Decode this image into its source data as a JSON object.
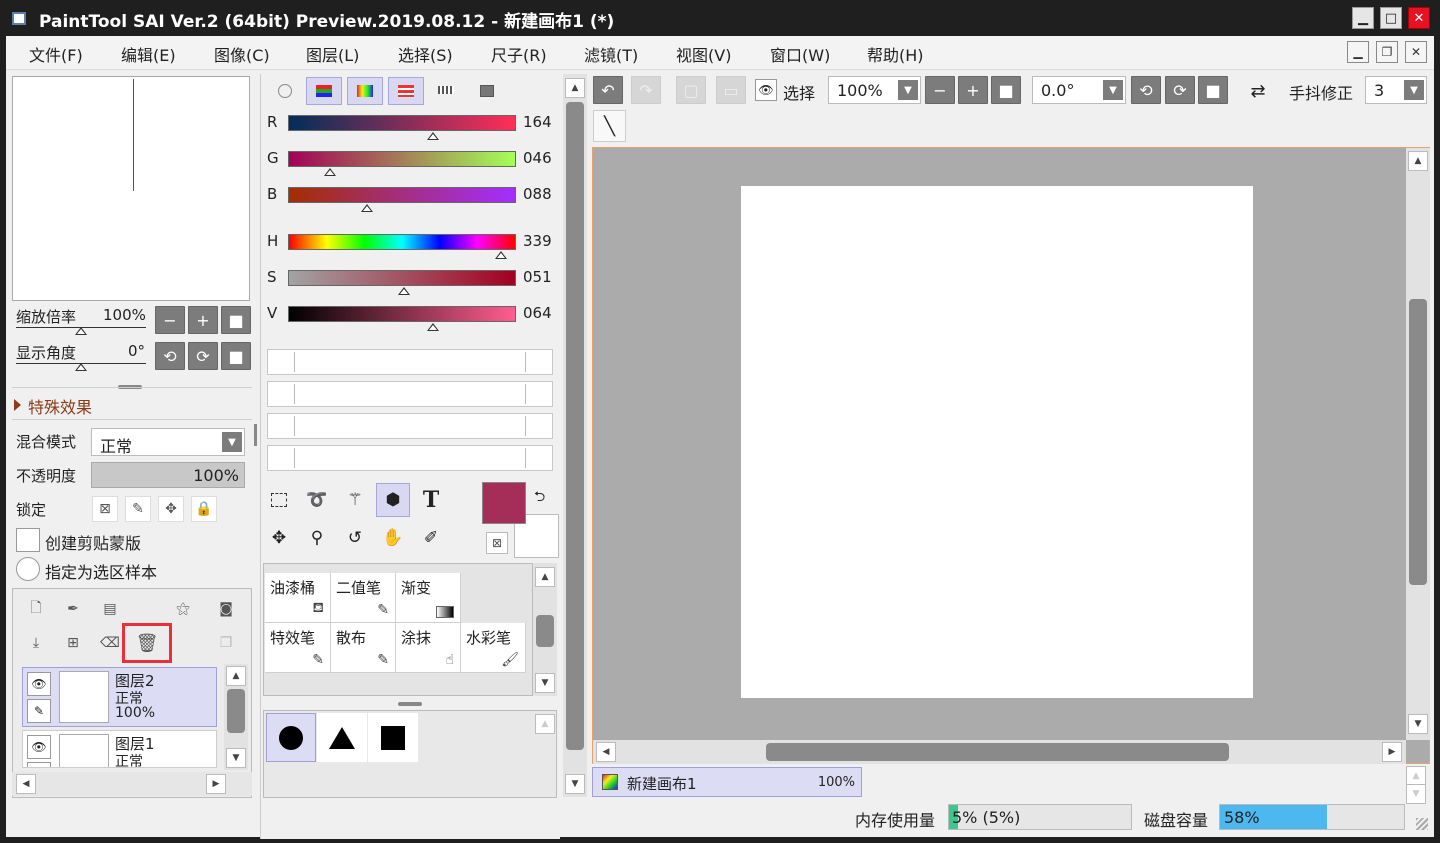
{
  "window": {
    "title": "PaintTool SAI Ver.2 (64bit) Preview.2019.08.12 - 新建画布1 (*)",
    "minimize": "▁",
    "maximize": "□",
    "close": "✕"
  },
  "menu": [
    "文件(F)",
    "编辑(E)",
    "图像(C)",
    "图层(L)",
    "选择(S)",
    "尺子(R)",
    "滤镜(T)",
    "视图(V)",
    "窗口(W)",
    "帮助(H)"
  ],
  "mdi_controls": [
    "▁",
    "❐",
    "✕"
  ],
  "navigator": {
    "zoom_label": "缩放倍率",
    "zoom_value": "100%",
    "angle_label": "显示角度",
    "angle_value": "0°"
  },
  "effects": {
    "label": "特殊效果"
  },
  "layer_props": {
    "blend_label": "混合模式",
    "blend_value": "正常",
    "opacity_label": "不透明度",
    "opacity_value": "100%",
    "lock_label": "锁定",
    "clip_label": "创建剪贴蒙版",
    "sample_label": "指定为选区样本"
  },
  "layers": [
    {
      "name": "图层2",
      "mode": "正常",
      "opacity": "100%"
    },
    {
      "name": "图层1",
      "mode": "正常"
    }
  ],
  "color": {
    "r_label": "R",
    "r_value": "164",
    "g_label": "G",
    "g_value": "046",
    "b_label": "B",
    "b_value": "088",
    "h_label": "H",
    "h_value": "339",
    "s_label": "S",
    "s_value": "051",
    "v_label": "V",
    "v_value": "064",
    "primary": "#a42e58",
    "secondary": "#ffffff"
  },
  "tools": {
    "text_icon": "T",
    "brushes": [
      {
        "name": "油漆桶"
      },
      {
        "name": "二值笔"
      },
      {
        "name": "渐变"
      },
      {
        "name": "特效笔"
      },
      {
        "name": "散布"
      },
      {
        "name": "涂抹"
      },
      {
        "name": "水彩笔"
      }
    ]
  },
  "toolbar": {
    "select_label": "选择",
    "zoom_value": "100%",
    "angle_value": "0.0°",
    "stabilizer_label": "手抖修正",
    "stabilizer_value": "3"
  },
  "canvas_tab": {
    "name": "新建画布1",
    "zoom": "100%"
  },
  "status": {
    "memory_label": "内存使用量",
    "memory_value": "5% (5%)",
    "memory_fraction": 0.05,
    "disk_label": "磁盘容量",
    "disk_value": "58%",
    "disk_fraction": 0.58
  },
  "colors": {
    "accent_blue": "#4db8f0",
    "memory_green": "#3cc88c",
    "highlight_red": "#e8303a"
  }
}
